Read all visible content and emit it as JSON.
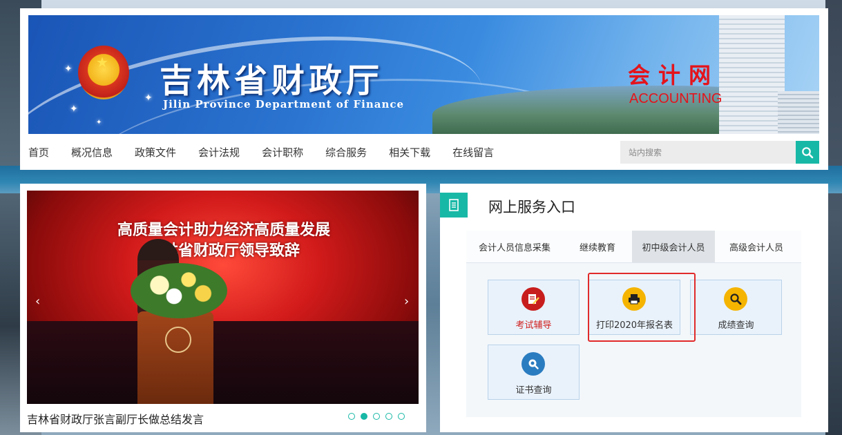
{
  "header": {
    "title_cn": "吉林省财政厅",
    "title_en": "Jilin Province Department of Finance",
    "accounting_cn": "会计网",
    "accounting_en": "ACCOUNTING"
  },
  "nav": {
    "items": [
      "首页",
      "概况信息",
      "政策文件",
      "会计法规",
      "会计职称",
      "综合服务",
      "相关下载",
      "在线留言"
    ]
  },
  "search": {
    "placeholder": "站内搜索",
    "icon": "search-icon",
    "button_color": "#18b8a6"
  },
  "news": {
    "slide_text_line1": "高质量会计助力经济高质量发展",
    "slide_text_line2": "吉林省财政厅领导致辞",
    "caption": "吉林省财政厅张言副厅长做总结发言",
    "dots_total": 5,
    "dots_active": 2
  },
  "services": {
    "title": "网上服务入口",
    "icon": "document-icon",
    "tabs": [
      "会计人员信息采集",
      "继续教育",
      "初中级会计人员",
      "高级会计人员"
    ],
    "active_tab": 3,
    "cards": [
      {
        "label": "考试辅导",
        "icon": "pencil-paper-icon",
        "color": "#c81d1d"
      },
      {
        "label": "打印2020年报名表",
        "icon": "printer-icon",
        "color": "#f5b400"
      },
      {
        "label": "成绩查询",
        "icon": "magnifier-icon",
        "color": "#f5b400"
      },
      {
        "label": "证书查询",
        "icon": "certificate-search-icon",
        "color": "#2a7cc0"
      }
    ]
  },
  "colors": {
    "accent": "#18b8a6",
    "highlight": "#e12a2a",
    "brand_red": "#e4141b"
  }
}
